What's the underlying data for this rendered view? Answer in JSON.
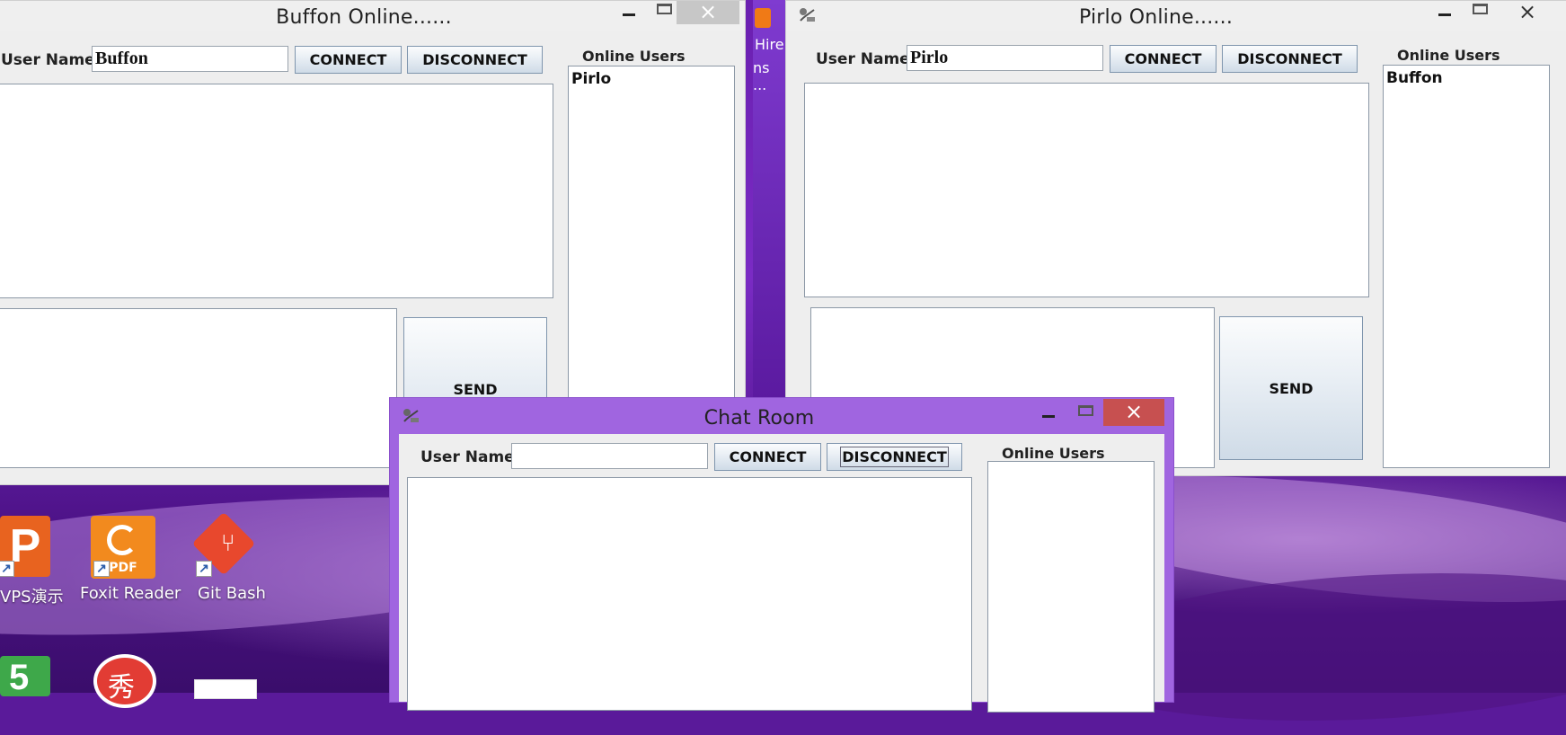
{
  "windows": {
    "buffon": {
      "title": "Buffon  Online......",
      "user_name_label": "User Name",
      "user_name_value": "Buffon",
      "connect_label": "CONNECT",
      "disconnect_label": "DISCONNECT",
      "online_users_label": "Online Users",
      "online_users": [
        "Pirlo"
      ],
      "send_label": "SEND"
    },
    "pirlo": {
      "title": "Pirlo  Online......",
      "user_name_label": "User Name",
      "user_name_value": "Pirlo",
      "connect_label": "CONNECT",
      "disconnect_label": "DISCONNECT",
      "online_users_label": "Online Users",
      "online_users": [
        "Buffon"
      ],
      "send_label": "SEND"
    },
    "chatroom": {
      "title": "Chat Room",
      "user_name_label": "User Name",
      "user_name_value": "",
      "connect_label": "CONNECT",
      "disconnect_label": "DISCONNECT",
      "online_users_label": "Online Users",
      "online_users": []
    }
  },
  "desktop": {
    "icons": [
      {
        "label": "VPS演示",
        "icon": "wps-presentation-icon"
      },
      {
        "label": "Foxit Reader",
        "icon": "foxit-reader-icon"
      },
      {
        "label": "Git Bash",
        "icon": "git-bash-icon"
      }
    ],
    "background_snippet": {
      "line1": "Hire",
      "line2": "ns ..."
    }
  },
  "colors": {
    "accent_purple": "#a065e0",
    "close_active": "#c75050",
    "button_border": "#7f95ad"
  }
}
